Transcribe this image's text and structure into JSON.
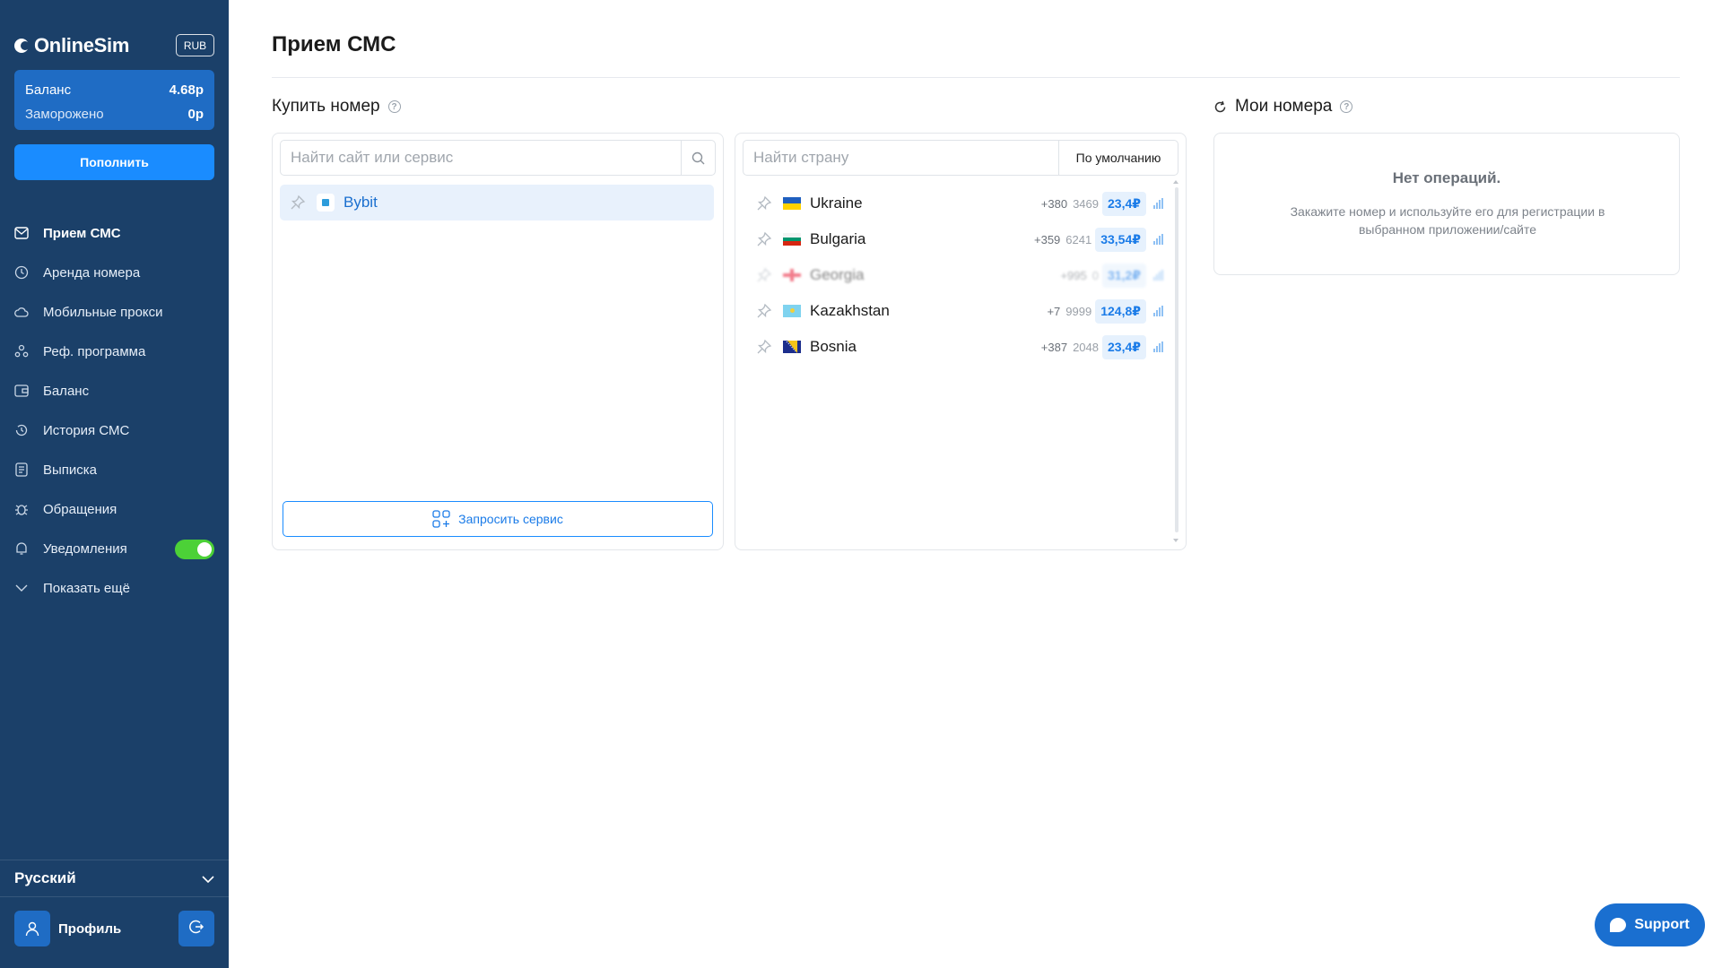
{
  "app": {
    "brand": "OnlineSim",
    "currency": "RUB"
  },
  "balance": {
    "label": "Баланс",
    "value": "4.68р",
    "frozen_label": "Заморожено",
    "frozen_value": "0р"
  },
  "topup_label": "Пополнить",
  "nav": [
    {
      "label": "Прием СМС",
      "icon": "mail-icon",
      "active": true
    },
    {
      "label": "Аренда номера",
      "icon": "clock-icon"
    },
    {
      "label": "Мобильные прокси",
      "icon": "cloud-icon"
    },
    {
      "label": "Реф. программа",
      "icon": "users-icon"
    },
    {
      "label": "Баланс",
      "icon": "wallet-icon"
    },
    {
      "label": "История СМС",
      "icon": "history-icon"
    },
    {
      "label": "Выписка",
      "icon": "document-icon"
    },
    {
      "label": "Обращения",
      "icon": "bug-icon"
    },
    {
      "label": "Уведомления",
      "icon": "bell-icon",
      "toggle": true
    },
    {
      "label": "Показать ещё",
      "icon": "chevron-down-icon"
    }
  ],
  "language": "Русский",
  "profile_label": "Профиль",
  "page_title": "Прием СМС",
  "buy": {
    "heading": "Купить номер",
    "service_search_placeholder": "Найти сайт или сервис",
    "services": [
      {
        "name": "Bybit",
        "icon": "bybit-logo-icon"
      }
    ],
    "request_service_label": "Запросить сервис",
    "country_search_placeholder": "Найти страну",
    "sort_label": "По умолчанию",
    "countries": [
      {
        "name": "Ukraine",
        "code": "+380",
        "count": "3469",
        "price": "23,4₽",
        "flag": "ukraine-flag-icon"
      },
      {
        "name": "Bulgaria",
        "code": "+359",
        "count": "6241",
        "price": "33,54₽",
        "flag": "bulgaria-flag-icon"
      },
      {
        "name": "Georgia",
        "code": "+995",
        "count": "0",
        "price": "31,2₽",
        "flag": "georgia-flag-icon",
        "unavailable": true
      },
      {
        "name": "Kazakhstan",
        "code": "+7",
        "count": "9999",
        "price": "124,8₽",
        "flag": "kazakhstan-flag-icon"
      },
      {
        "name": "Bosnia",
        "code": "+387",
        "count": "2048",
        "price": "23,4₽",
        "flag": "bosnia-flag-icon"
      }
    ]
  },
  "my_numbers": {
    "heading": "Мои номера",
    "empty_title": "Нет операций.",
    "empty_text": "Закажите номер и используйте его для регистрации в выбранном приложении/сайте"
  },
  "support_label": "Support",
  "colors": {
    "sidebar_bg": "#1b4069",
    "accent": "#1a8cff",
    "balance_card": "#1f6cc4",
    "toggle_on": "#4cd137",
    "price_text": "#1a7be8",
    "price_bg": "#e6f1fd"
  }
}
